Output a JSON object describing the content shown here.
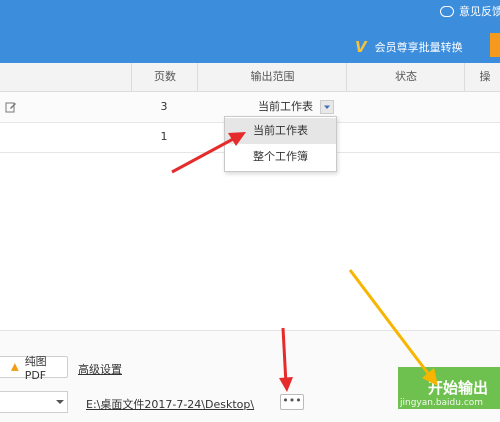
{
  "topbar": {
    "feedback_label": "意见反馈",
    "batch_label": "会员尊享批量转换",
    "accent": "#3c8ddc",
    "cta_color": "#f59a1d"
  },
  "table": {
    "headers": [
      "页数",
      "输出范围",
      "状态",
      "操"
    ],
    "rows": [
      {
        "pages": "3",
        "range": "当前工作表"
      },
      {
        "pages": "1",
        "range": ""
      }
    ]
  },
  "dropdown": {
    "options": [
      "当前工作表",
      "整个工作簿"
    ],
    "selected": "当前工作表"
  },
  "bottom": {
    "pdf_mode_label": "纯图PDF",
    "advanced_label": "高级设置",
    "output_path": "E:\\桌面文件2017-7-24\\Desktop\\",
    "more_label": "•••",
    "start_label": "开始输出",
    "start_color": "#6fc14f"
  },
  "watermark": "jingyan.baidu.com"
}
